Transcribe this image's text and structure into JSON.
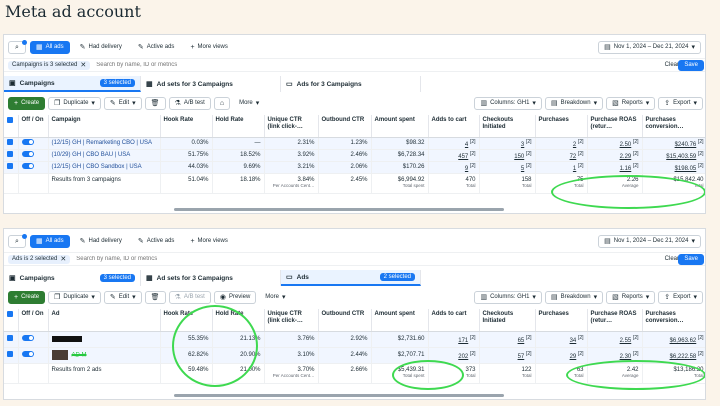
{
  "page_title": "Meta ad account",
  "panels": [
    {
      "toolbar": {
        "all_ads": "All ads",
        "had_delivery": "Had delivery",
        "active_ads": "Active ads",
        "more_views": "More views",
        "date_range": "Nov 1, 2024 – Dec 21, 2024"
      },
      "filter": {
        "chip": "Campaigns is 3 selected",
        "placeholder": "Search by name, ID or metrics",
        "clear": "Clear",
        "save": "Save"
      },
      "tabs": {
        "campaigns": "Campaigns",
        "campaigns_badge": "3 selected",
        "adsets": "Ad sets for 3 Campaigns",
        "ads": "Ads for 3 Campaigns"
      },
      "actions": {
        "create": "Create",
        "duplicate": "Duplicate",
        "edit": "Edit",
        "ab_test": "A/B test",
        "more": "More",
        "columns": "Columns: GH1",
        "breakdown": "Breakdown",
        "reports": "Reports",
        "export": "Export"
      },
      "columns": [
        "Off / On",
        "Campaign",
        "Hook Rate",
        "Hold Rate",
        "Unique CTR (link click-…",
        "Outbound CTR",
        "Amount spent",
        "Adds to cart",
        "Checkouts Initiated",
        "Purchases",
        "Purchase ROAS (retur…",
        "Purchases conversion…"
      ],
      "rows": [
        {
          "name": "(12/15) GH | Remarketing CBO | USA",
          "hook": "0.03%",
          "hold": "—",
          "uctr": "2.31%",
          "octr": "1.23%",
          "spent": "$98.32",
          "atc": "4",
          "atc_sup": "[2]",
          "ci": "3",
          "ci_sup": "[2]",
          "purch": "2",
          "purch_sup": "[2]",
          "roas": "2.50",
          "roas_sup": "[2]",
          "value": "$240.76",
          "value_sup": "[2]"
        },
        {
          "name": "(10/29) GH | CBO BAU | USA",
          "hook": "51.75%",
          "hold": "18.52%",
          "uctr": "3.92%",
          "octr": "2.46%",
          "spent": "$6,728.34",
          "atc": "457",
          "atc_sup": "[2]",
          "ci": "150",
          "ci_sup": "[2]",
          "purch": "72",
          "purch_sup": "[2]",
          "roas": "2.29",
          "roas_sup": "[2]",
          "value": "$15,403.59",
          "value_sup": "[2]"
        },
        {
          "name": "(12/15) GH | CBO Sandbox | USA",
          "hook": "44.03%",
          "hold": "9.69%",
          "uctr": "3.21%",
          "octr": "2.06%",
          "spent": "$170.26",
          "atc": "9",
          "atc_sup": "[2]",
          "ci": "5",
          "ci_sup": "[2]",
          "purch": "1",
          "purch_sup": "[2]",
          "roas": "1.16",
          "roas_sup": "[2]",
          "value": "$198.05",
          "value_sup": "[2]"
        }
      ],
      "total": {
        "label": "Results from 3 campaigns",
        "hook": "51.04%",
        "hold": "18.18%",
        "uctr": "3.84%",
        "uctr_sub": "Per Accounts Cent…",
        "octr": "2.45%",
        "spent": "$6,994.92",
        "spent_sub": "Total spent",
        "atc": "470",
        "atc_sub": "Total",
        "ci": "158",
        "ci_sub": "Total",
        "purch": "75",
        "purch_sub": "Total",
        "roas": "2.26",
        "roas_sub": "Average",
        "value": "$15,842.40",
        "value_sub": "Total"
      }
    },
    {
      "toolbar": {
        "all_ads": "All ads",
        "had_delivery": "Had delivery",
        "active_ads": "Active ads",
        "more_views": "More views",
        "date_range": "Nov 1, 2024 – Dec 21, 2024"
      },
      "filter": {
        "chip": "Ads is 2 selected",
        "placeholder": "Search by name, ID or metrics",
        "clear": "Clear",
        "save": "Save"
      },
      "tabs": {
        "campaigns": "Campaigns",
        "campaigns_badge": "3 selected",
        "adsets": "Ad sets for 3 Campaigns",
        "ads": "Ads",
        "ads_badge": "2 selected"
      },
      "actions": {
        "create": "Create",
        "duplicate": "Duplicate",
        "edit": "Edit",
        "ab_test": "A/B test",
        "preview": "Preview",
        "more": "More",
        "columns": "Columns: GH1",
        "breakdown": "Breakdown",
        "reports": "Reports",
        "export": "Export"
      },
      "columns": [
        "Off / On",
        "Ad",
        "Hook Rate",
        "Hold Rate",
        "Unique CTR (link click-…",
        "Outbound CTR",
        "Amount spent",
        "Adds to cart",
        "Checkouts Initiated",
        "Purchases",
        "Purchase ROAS (retur…",
        "Purchases conversion…"
      ],
      "rows": [
        {
          "name": "",
          "hook": "55.35%",
          "hold": "21.13%",
          "uctr": "3.76%",
          "octr": "2.92%",
          "spent": "$2,731.60",
          "atc": "171",
          "atc_sup": "[2]",
          "ci": "65",
          "ci_sup": "[2]",
          "purch": "34",
          "purch_sup": "[2]",
          "roas": "2.55",
          "roas_sup": "[2]",
          "value": "$6,963.62",
          "value_sup": "[2]"
        },
        {
          "name": "AD M",
          "hook": "62.82%",
          "hold": "20.90%",
          "uctr": "3.10%",
          "octr": "2.44%",
          "spent": "$2,707.71",
          "atc": "202",
          "atc_sup": "[2]",
          "ci": "57",
          "ci_sup": "[2]",
          "purch": "29",
          "purch_sup": "[2]",
          "roas": "2.30",
          "roas_sup": "[2]",
          "value": "$6,222.58",
          "value_sup": "[2]"
        }
      ],
      "total": {
        "label": "Results from 2 ads",
        "hook": "59.48%",
        "hold": "21.00%",
        "uctr": "3.70%",
        "uctr_sub": "Per Accounts Cent…",
        "octr": "2.66%",
        "spent": "$5,439.31",
        "spent_sub": "Total spent",
        "atc": "373",
        "atc_sub": "Total",
        "ci": "122",
        "ci_sub": "Total",
        "purch": "63",
        "purch_sub": "Total",
        "roas": "2.42",
        "roas_sub": "Average",
        "value": "$13,186.20",
        "value_sub": "Total"
      }
    }
  ]
}
